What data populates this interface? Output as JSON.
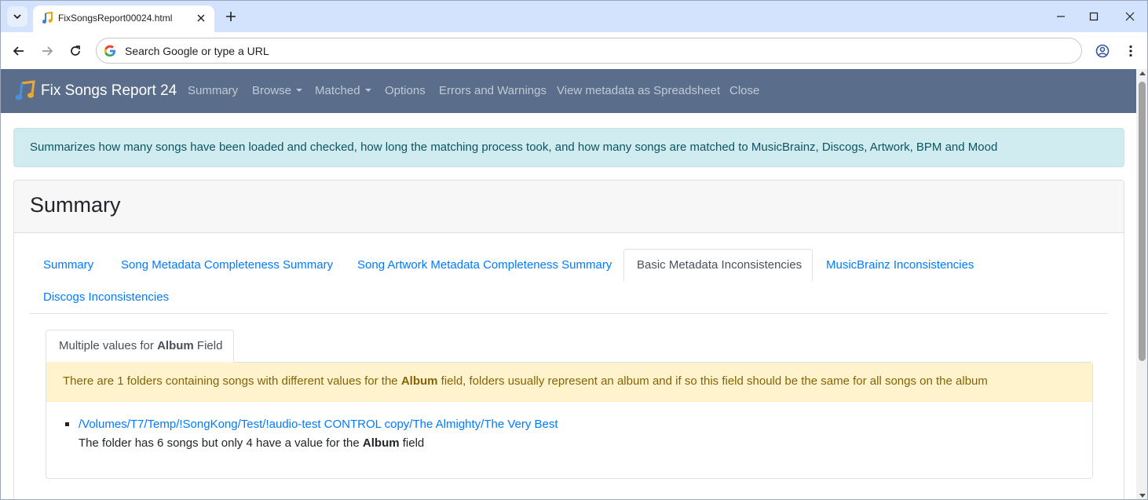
{
  "browser": {
    "tab_title": "FixSongsReport00024.html",
    "omnibox_placeholder": "Search Google or type a URL"
  },
  "navbar": {
    "brand": "Fix Songs Report 24",
    "items": [
      {
        "label": "Summary",
        "dropdown": false
      },
      {
        "label": "Browse",
        "dropdown": true
      },
      {
        "label": "Matched",
        "dropdown": true
      },
      {
        "label": "Options",
        "dropdown": false
      },
      {
        "label": "Errors and Warnings",
        "dropdown": false
      },
      {
        "label": "View metadata as Spreadsheet",
        "dropdown": false
      },
      {
        "label": "Close",
        "dropdown": false
      }
    ]
  },
  "info_alert": "Summarizes how many songs have been loaded and checked, how long the matching process took, and how many songs are matched to MusicBrainz, Discogs, Artwork, BPM and Mood",
  "card": {
    "title": "Summary",
    "tabs": [
      {
        "label": "Summary",
        "active": false
      },
      {
        "label": "Song Metadata Completeness Summary",
        "active": false
      },
      {
        "label": "Song Artwork Metadata Completeness Summary",
        "active": false
      },
      {
        "label": "Basic Metadata Inconsistencies",
        "active": true
      },
      {
        "label": "MusicBrainz Inconsistencies",
        "active": false
      },
      {
        "label": "Discogs Inconsistencies",
        "active": false
      }
    ],
    "inner_tab": {
      "prefix": "Multiple values for ",
      "field": "Album",
      "suffix": " Field"
    },
    "warning": {
      "prefix": "There are 1 folders containing songs with different values for the ",
      "field": "Album",
      "suffix": " field, folders usually represent an album and if so this field should be the same for all songs on the album"
    },
    "folders": [
      {
        "path": "/Volumes/T7/Temp/!SongKong/Test/!audio-test CONTROL copy/The Almighty/The Very Best",
        "desc_prefix": "The folder has 6 songs but only 4 have a value for the ",
        "desc_field": "Album",
        "desc_suffix": " field"
      }
    ]
  },
  "colors": {
    "navbar_bg": "#5a6e8c",
    "link": "#007bff",
    "info_bg": "#d1ecf1",
    "warning_bg": "#fff3cd",
    "tabstrip_bg": "#d3e3fd"
  }
}
